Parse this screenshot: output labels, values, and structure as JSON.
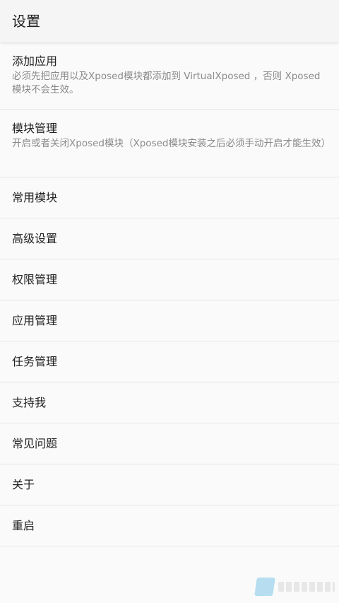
{
  "header": {
    "title": "设置"
  },
  "settings": [
    {
      "title": "添加应用",
      "summary": "必须先把应用以及Xposed模块都添加到 VirtualXposed ，否则 Xposed模块不会生效。"
    },
    {
      "title": "模块管理",
      "summary": "开启或者关闭Xposed模块（Xposed模块安装之后必须手动开启才能生效）"
    },
    {
      "title": "常用模块"
    },
    {
      "title": "高级设置"
    },
    {
      "title": "权限管理"
    },
    {
      "title": "应用管理"
    },
    {
      "title": "任务管理"
    },
    {
      "title": "支持我"
    },
    {
      "title": "常见问题"
    },
    {
      "title": "关于"
    },
    {
      "title": "重启"
    }
  ],
  "colors": {
    "background": "#fafafa",
    "app_bar": "#f5f5f5",
    "divider": "#e6e6e6",
    "title_text": "#222222",
    "summary_text": "#8a8a8a"
  }
}
